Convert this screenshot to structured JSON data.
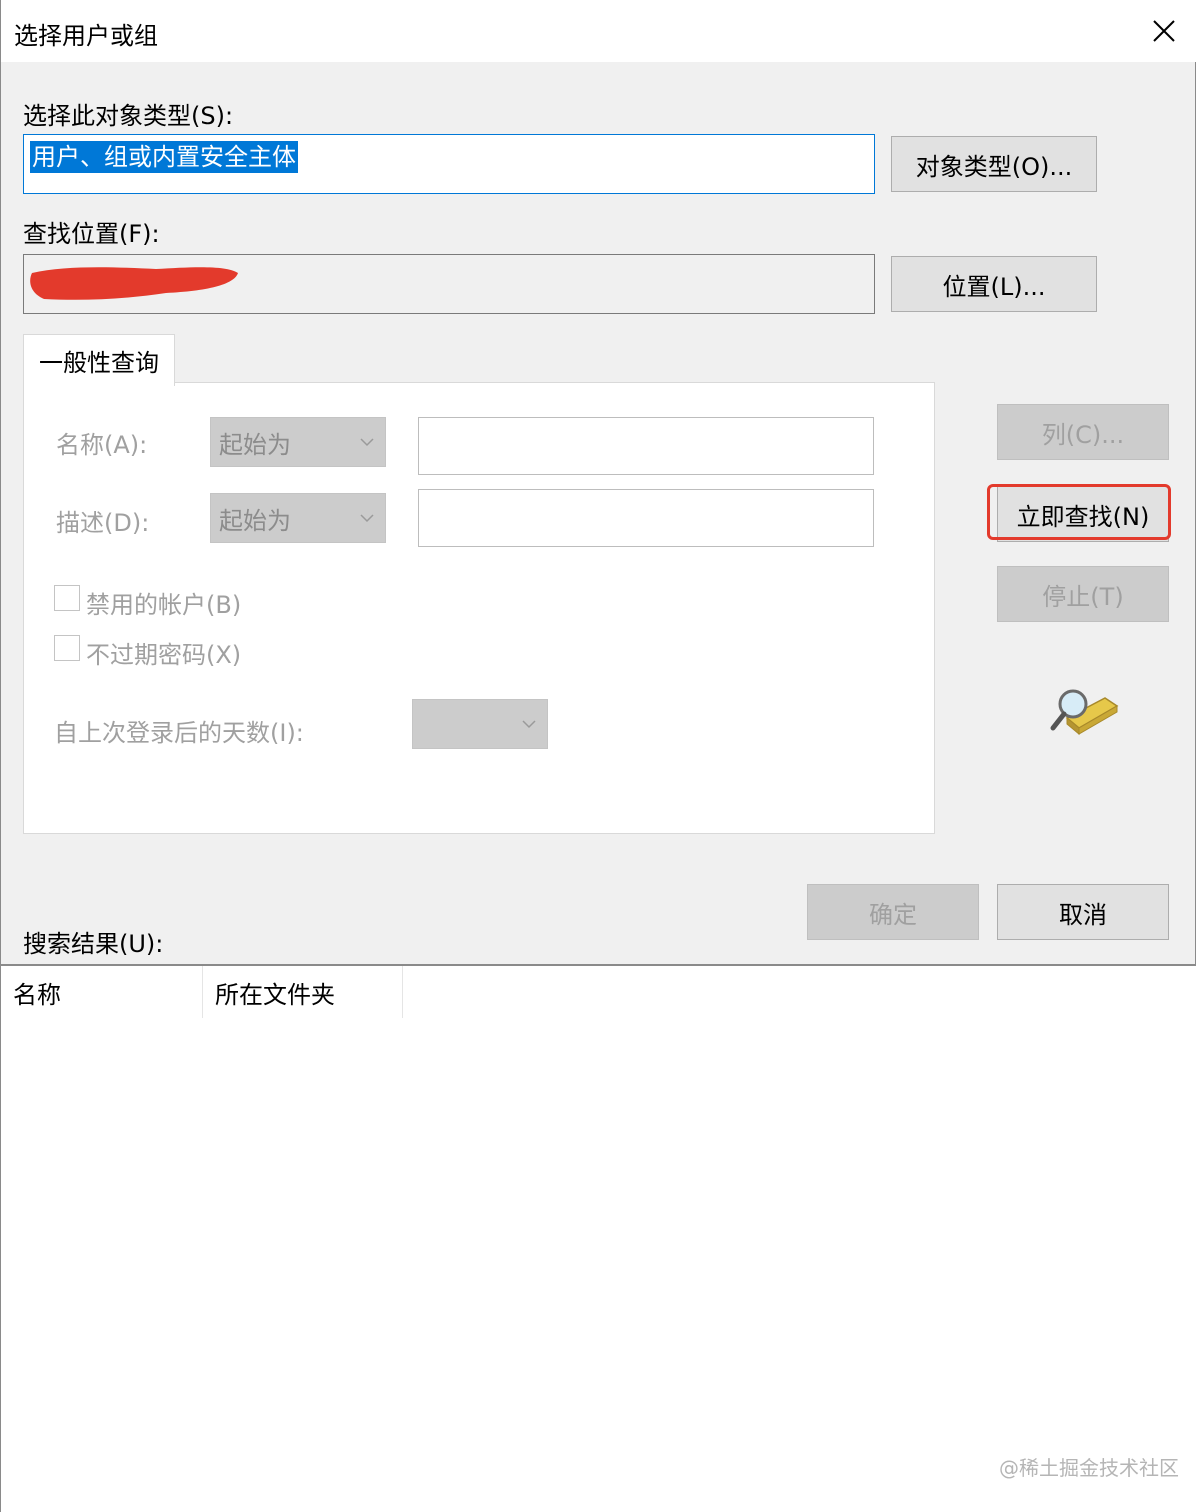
{
  "window": {
    "title": "选择用户或组"
  },
  "object_type": {
    "label": "选择此对象类型(S):",
    "value": "用户、组或内置安全主体",
    "button": "对象类型(O)..."
  },
  "location": {
    "label": "查找位置(F):",
    "button": "位置(L)..."
  },
  "query_tab": {
    "label": "一般性查询",
    "name_label": "名称(A):",
    "name_mode": "起始为",
    "desc_label": "描述(D):",
    "desc_mode": "起始为",
    "disabled_accounts": "禁用的帐户(B)",
    "non_expiring_pwd": "不过期密码(X)",
    "days_label": "自上次登录后的天数(I):"
  },
  "side_buttons": {
    "columns": "列(C)...",
    "find_now": "立即查找(N)",
    "stop": "停止(T)"
  },
  "footer_buttons": {
    "ok": "确定",
    "cancel": "取消"
  },
  "results": {
    "label": "搜索结果(U):",
    "columns": [
      "名称",
      "所在文件夹"
    ]
  },
  "watermark": "@稀土掘金技术社区",
  "colors": {
    "selection": "#0078d7",
    "annotation": "#e33a2c",
    "redaction": "#e33a2c"
  },
  "icons": {
    "close": "close-icon",
    "search": "search-directory-icon"
  }
}
